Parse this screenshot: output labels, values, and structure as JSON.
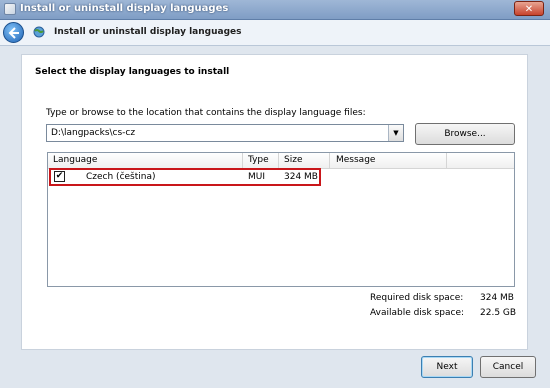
{
  "window": {
    "title": "Install or uninstall display languages",
    "close_label": "✕"
  },
  "header": {
    "title": "Install or uninstall display languages"
  },
  "content": {
    "section_title": "Select the display languages to install",
    "instruction": "Type or browse to the location that contains the display language files:",
    "path_value": "D:\\langpacks\\cs-cz",
    "browse_label": "Browse..."
  },
  "list": {
    "columns": [
      "Language",
      "Type",
      "Size",
      "Message"
    ],
    "rows": [
      {
        "checked": true,
        "language": "Czech (čeština)",
        "type": "MUI",
        "size": "324 MB",
        "message": ""
      }
    ]
  },
  "disk": {
    "required_label": "Required disk space:",
    "required_value": "324 MB",
    "available_label": "Available disk space:",
    "available_value": "22.5 GB"
  },
  "buttons": {
    "next": "Next",
    "cancel": "Cancel"
  },
  "colors": {
    "highlight": "#c9161a",
    "titlebar": "#8aa8cf"
  }
}
